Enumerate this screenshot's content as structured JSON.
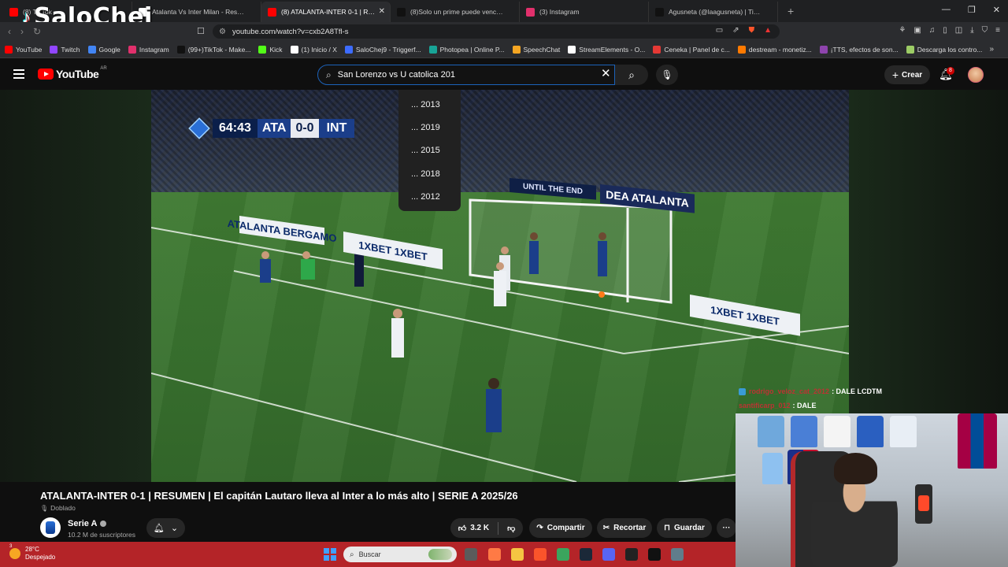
{
  "browser": {
    "tabs": [
      {
        "title": "(8) TikTok",
        "favicon_color": "#ff0000",
        "active": false
      },
      {
        "title": "Atalanta Vs Inter Milan - Resultado",
        "favicon_color": "#ffffff",
        "active": false
      },
      {
        "title": "(8) ATALANTA-INTER 0-1 | RESUMEN",
        "favicon_color": "#ff0000",
        "active": true
      },
      {
        "title": "(8)Solo un prime puede vencerme 🙂",
        "favicon_color": "#111111",
        "active": false
      },
      {
        "title": "(3) Instagram",
        "favicon_color": "#e1306c",
        "active": false
      },
      {
        "title": "Agusneta (@laagusneta) | TikTok",
        "favicon_color": "#111111",
        "active": false
      }
    ],
    "new_tab": "+",
    "url": "youtube.com/watch?v=cxb2A8Tfl-s",
    "bookmarks": [
      {
        "label": "YouTube",
        "color": "#ff0000"
      },
      {
        "label": "Twitch",
        "color": "#9146ff"
      },
      {
        "label": "Google",
        "color": "#4285f4"
      },
      {
        "label": "Instagram",
        "color": "#e1306c"
      },
      {
        "label": "(99+)TikTok - Make...",
        "color": "#111111"
      },
      {
        "label": "Kick",
        "color": "#53fc18"
      },
      {
        "label": "(1) Inicio / X",
        "color": "#ffffff"
      },
      {
        "label": "SaloChej9 - Triggerf...",
        "color": "#3d6cff"
      },
      {
        "label": "Photopea | Online P...",
        "color": "#18a497"
      },
      {
        "label": "SpeechChat",
        "color": "#f5a623"
      },
      {
        "label": "StreamElements - O...",
        "color": "#ffffff"
      },
      {
        "label": "Ceneka | Panel de c...",
        "color": "#e53935"
      },
      {
        "label": "destream - monetiz...",
        "color": "#ff7a00"
      },
      {
        "label": "¡TTS, efectos de son...",
        "color": "#8e44ad"
      },
      {
        "label": "Descarga los contro...",
        "color": "#9ccc65"
      }
    ]
  },
  "youtube": {
    "logo_text": "YouTube",
    "country_code": "AR",
    "search": {
      "value": "San Lorenzo vs U catolica 201",
      "suggestions": [
        "... 2013",
        "... 2019",
        "... 2015",
        "... 2018",
        "... 2012"
      ]
    },
    "create_label": "Crear",
    "notification_count": "8"
  },
  "scorebug": {
    "time": "64:43",
    "home": "ATA",
    "score": "0-0",
    "away": "INT"
  },
  "pitch_ads": [
    "ATALANTA BERGAMO",
    "1XBET 1XBET",
    "1XBET 1XBET",
    "UNTIL THE END",
    "DEA ATALANTA"
  ],
  "video_info": {
    "title": "ATALANTA-INTER 0-1 | RESUMEN | El capitán Lautaro lleva al Inter a lo más alto | SERIE A 2025/26",
    "dubbed_label": "Doblado",
    "channel_name": "Serie A",
    "subscribers": "10.2 M de suscriptores",
    "likes": "3.2 K",
    "share_label": "Compartir",
    "clip_label": "Recortar",
    "save_label": "Guardar",
    "more_label": "···"
  },
  "stream_overlay": {
    "watermark": "SaloChej",
    "chat": [
      {
        "user": "rodrigo_veloz_cat_2012",
        "message": ": DALE LCDTM"
      },
      {
        "user": "santificarp_012",
        "message": ": DALE"
      }
    ]
  },
  "taskbar": {
    "temperature": "28°C",
    "weather_desc": "Despejado",
    "weather_badge": "3",
    "search_placeholder": "Buscar"
  }
}
